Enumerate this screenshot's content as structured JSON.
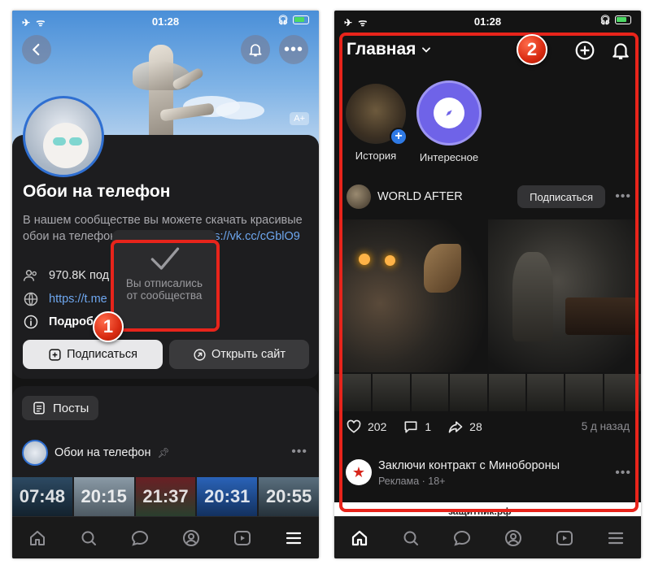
{
  "left_screen": {
    "status": {
      "time": "01:28"
    },
    "header": {
      "back_icon": "chevron-left-icon",
      "bell_icon": "bell-icon",
      "more_icon": "more-icon"
    },
    "badge": "A+",
    "community": {
      "name": "Обои на телефон",
      "description_prefix": "В нашем сообществе вы можете скачать красивые обои на телефон. Реестр РКН: ",
      "description_link": "https://vk.cc/cGblO9",
      "members": "970.8K под",
      "site_link": "https://t.me",
      "more_label": "Подроб"
    },
    "buttons": {
      "subscribe": "Подписаться",
      "open_site": "Открыть сайт"
    },
    "toast": {
      "line1": "Вы отписались",
      "line2": "от сообщества"
    },
    "posts": {
      "chip_label": "Посты",
      "author": "Обои на телефон"
    },
    "wallpapers": [
      "07:48",
      "20:15",
      "21:37",
      "20:31",
      "20:55"
    ],
    "annotation": "1"
  },
  "right_screen": {
    "status": {
      "time": "01:28"
    },
    "header": {
      "title": "Главная"
    },
    "stories": [
      {
        "label": "История"
      },
      {
        "label": "Интересное"
      }
    ],
    "post": {
      "author": "WORLD AFTER",
      "subscribe": "Подписаться",
      "likes": "202",
      "comments": "1",
      "shares": "28",
      "time_ago": "5 д назад"
    },
    "ad": {
      "title": "Заключи контракт с Минобороны",
      "sub": "Реклама · 18+"
    },
    "strip_text": "защитник.рф",
    "annotation": "2"
  },
  "colors": {
    "accent": "#2f6fd1",
    "link": "#6ea7ef",
    "annotation": "#e8241b",
    "background": "#141414"
  }
}
